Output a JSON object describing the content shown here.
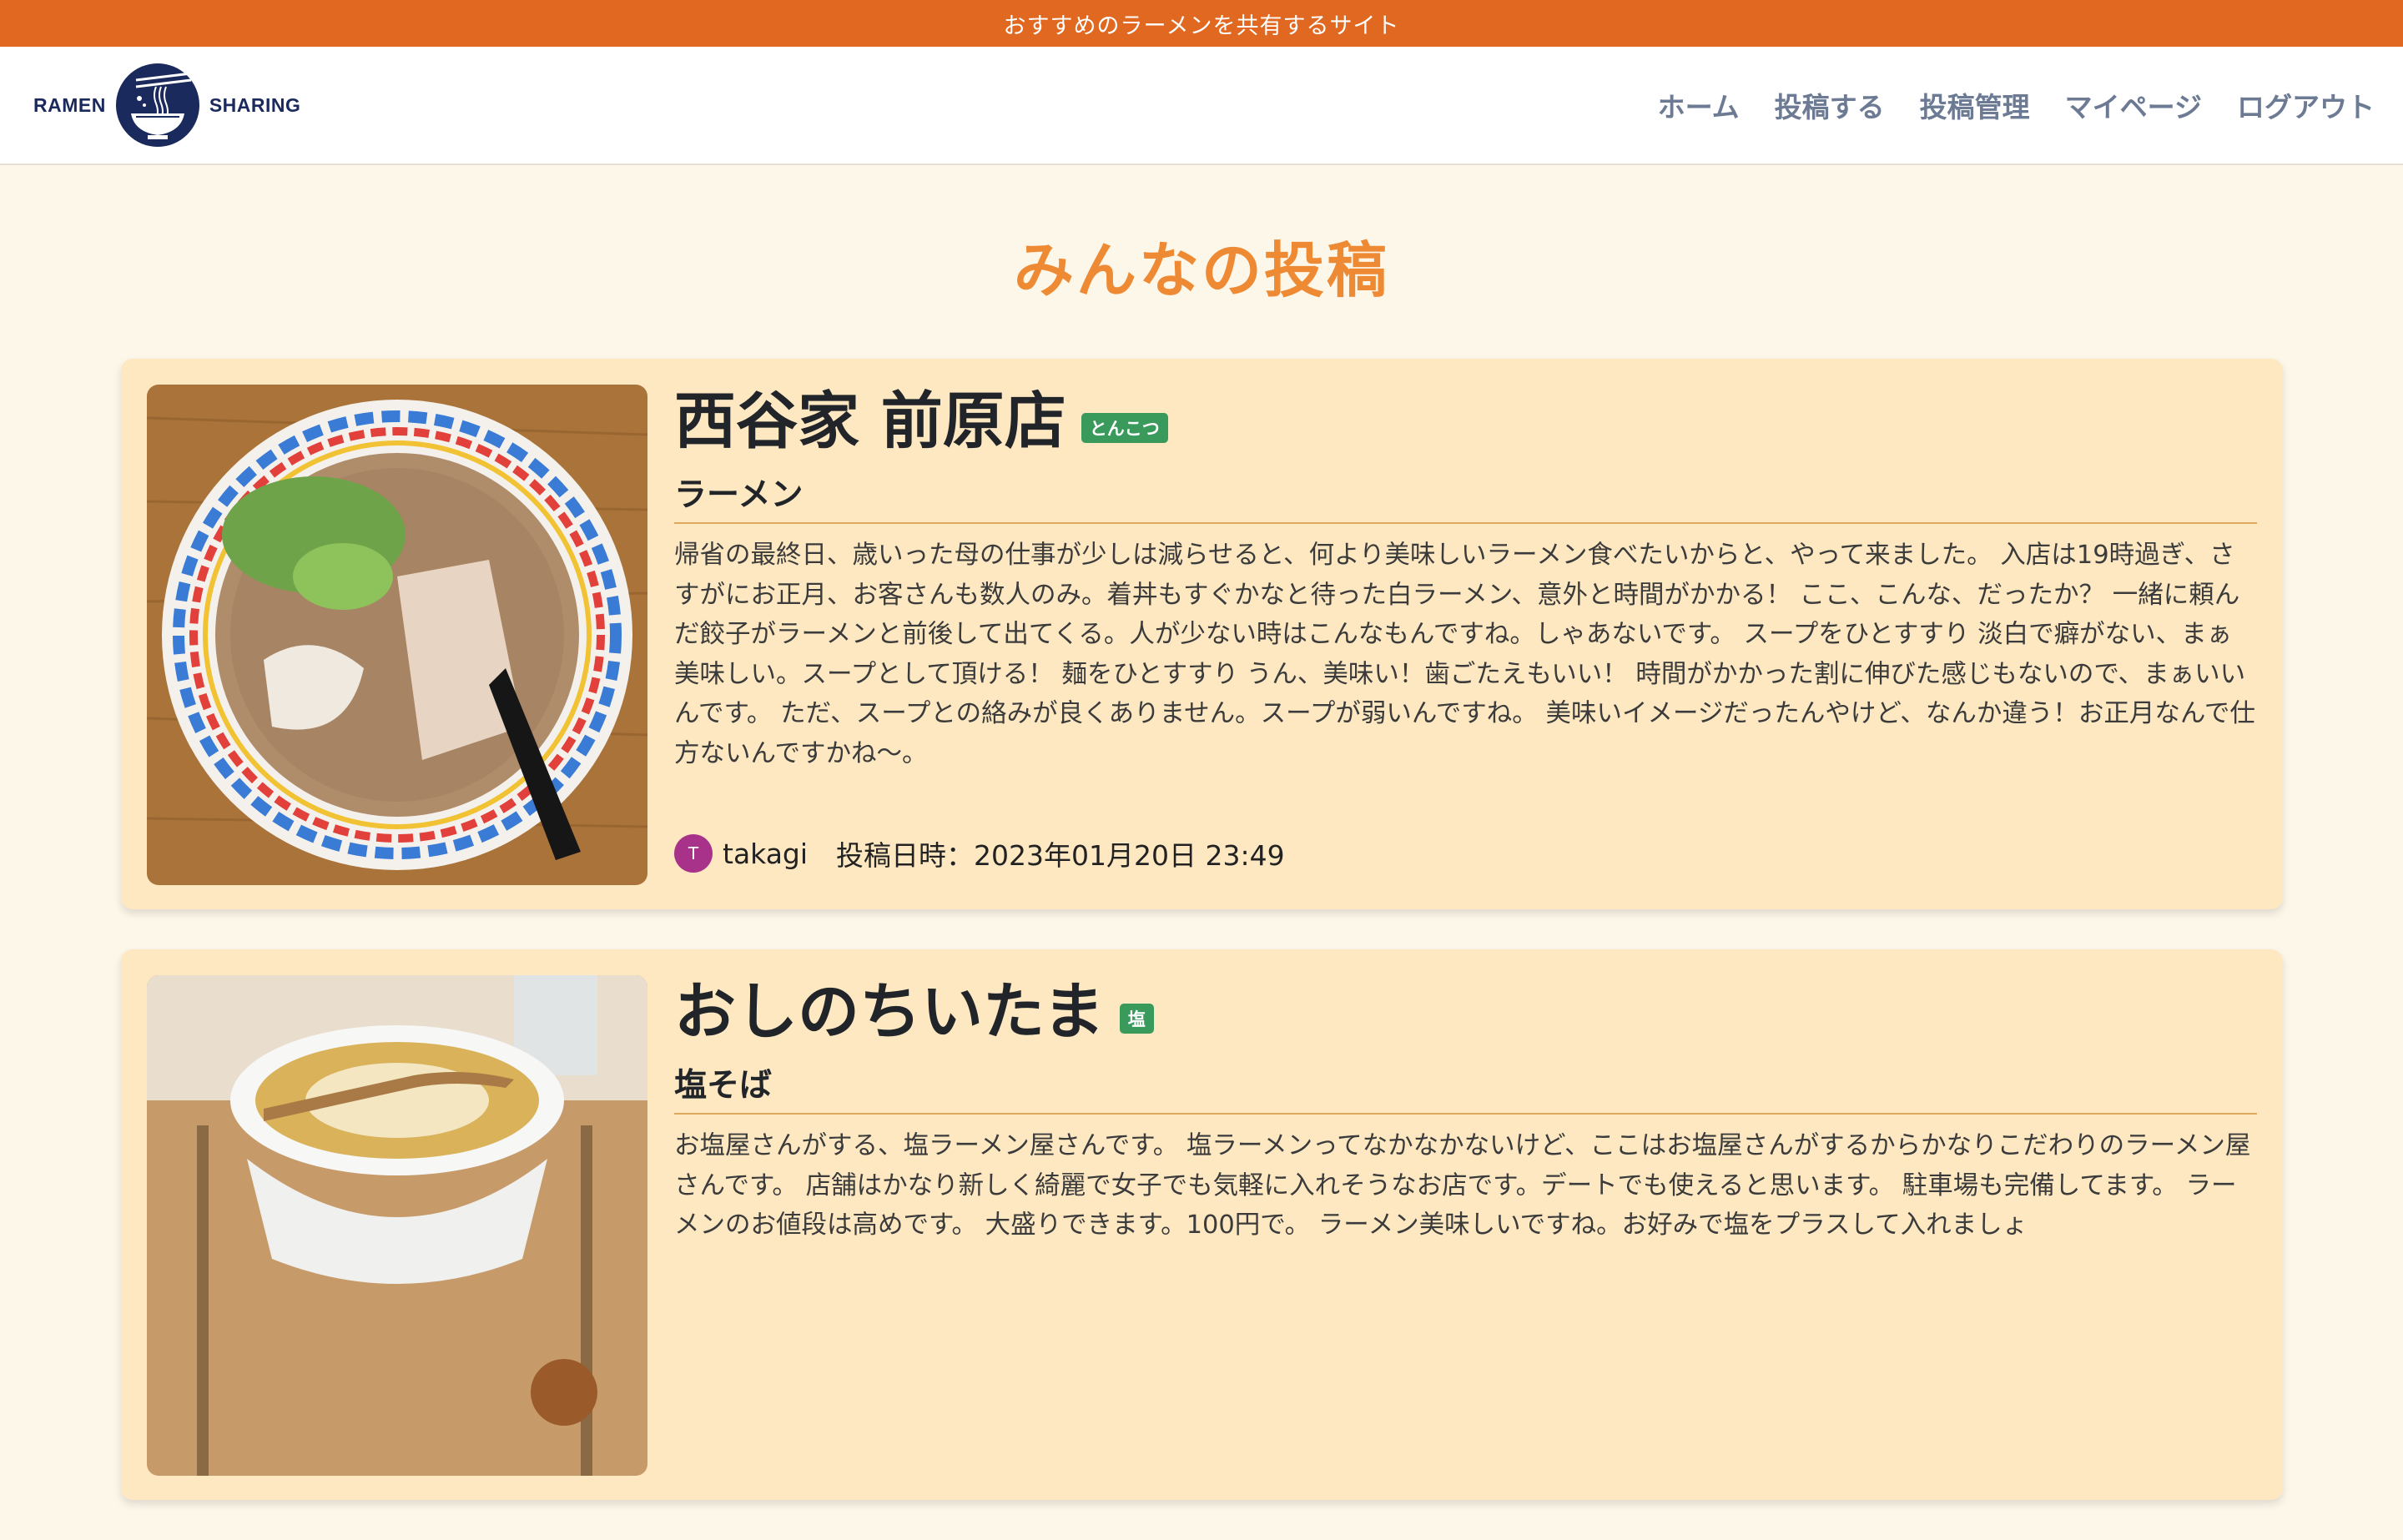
{
  "topbar": {
    "text": "おすすめのラーメンを共有するサイト"
  },
  "brand": {
    "left": "RAMEN",
    "right": "SHARING"
  },
  "nav": {
    "items": [
      {
        "label": "ホーム"
      },
      {
        "label": "投稿する"
      },
      {
        "label": "投稿管理"
      },
      {
        "label": "マイページ"
      },
      {
        "label": "ログアウト"
      }
    ]
  },
  "page": {
    "title": "みんなの投稿"
  },
  "posts": [
    {
      "shop": "西谷家 前原店",
      "tag": "とんこつ",
      "menu": "ラーメン",
      "body": "帰省の最終日、歳いった母の仕事が少しは減らせると、何より美味しいラーメン食べたいからと、やって来ました。 入店は19時過ぎ、さすがにお正月、お客さんも数人のみ。着丼もすぐかなと待った白ラーメン、意外と時間がかかる！ ここ、こんな、だったか？ 一緒に頼んだ餃子がラーメンと前後して出てくる。人が少ない時はこんなもんですね。しゃあないです。 スープをひとすすり 淡白で癖がない、まぁ美味しい。スープとして頂ける！ 麺をひとすすり うん、美味い！歯ごたえもいい！ 時間がかかった割に伸びた感じもないので、まぁいいんです。 ただ、スープとの絡みが良くありません。スープが弱いんですね。 美味いイメージだったんやけど、なんか違う！お正月なんで仕方ないんですかね〜。",
      "avatar": "T",
      "user": "takagi",
      "date": "投稿日時：2023年01月20日 23:49"
    },
    {
      "shop": "おしのちいたま",
      "tag": "塩",
      "menu": "塩そば",
      "body": "お塩屋さんがする、塩ラーメン屋さんです。 塩ラーメンってなかなかないけど、ここはお塩屋さんがするからかなりこだわりのラーメン屋さんです。 店舗はかなり新しく綺麗で女子でも気軽に入れそうなお店です。デートでも使えると思います。 駐車場も完備してます。 ラーメンのお値段は高めです。 大盛りできます。100円で。 ラーメン美味しいですね。お好みで塩をプラスして入れましょ",
      "avatar": "",
      "user": "",
      "date": ""
    }
  ],
  "colors": {
    "topbar": "#e06820",
    "title": "#ee8a34",
    "card": "#fde8c2",
    "tag": "#3a9a5c",
    "nav": "#6c7a93",
    "avatar": "#a8328a"
  }
}
